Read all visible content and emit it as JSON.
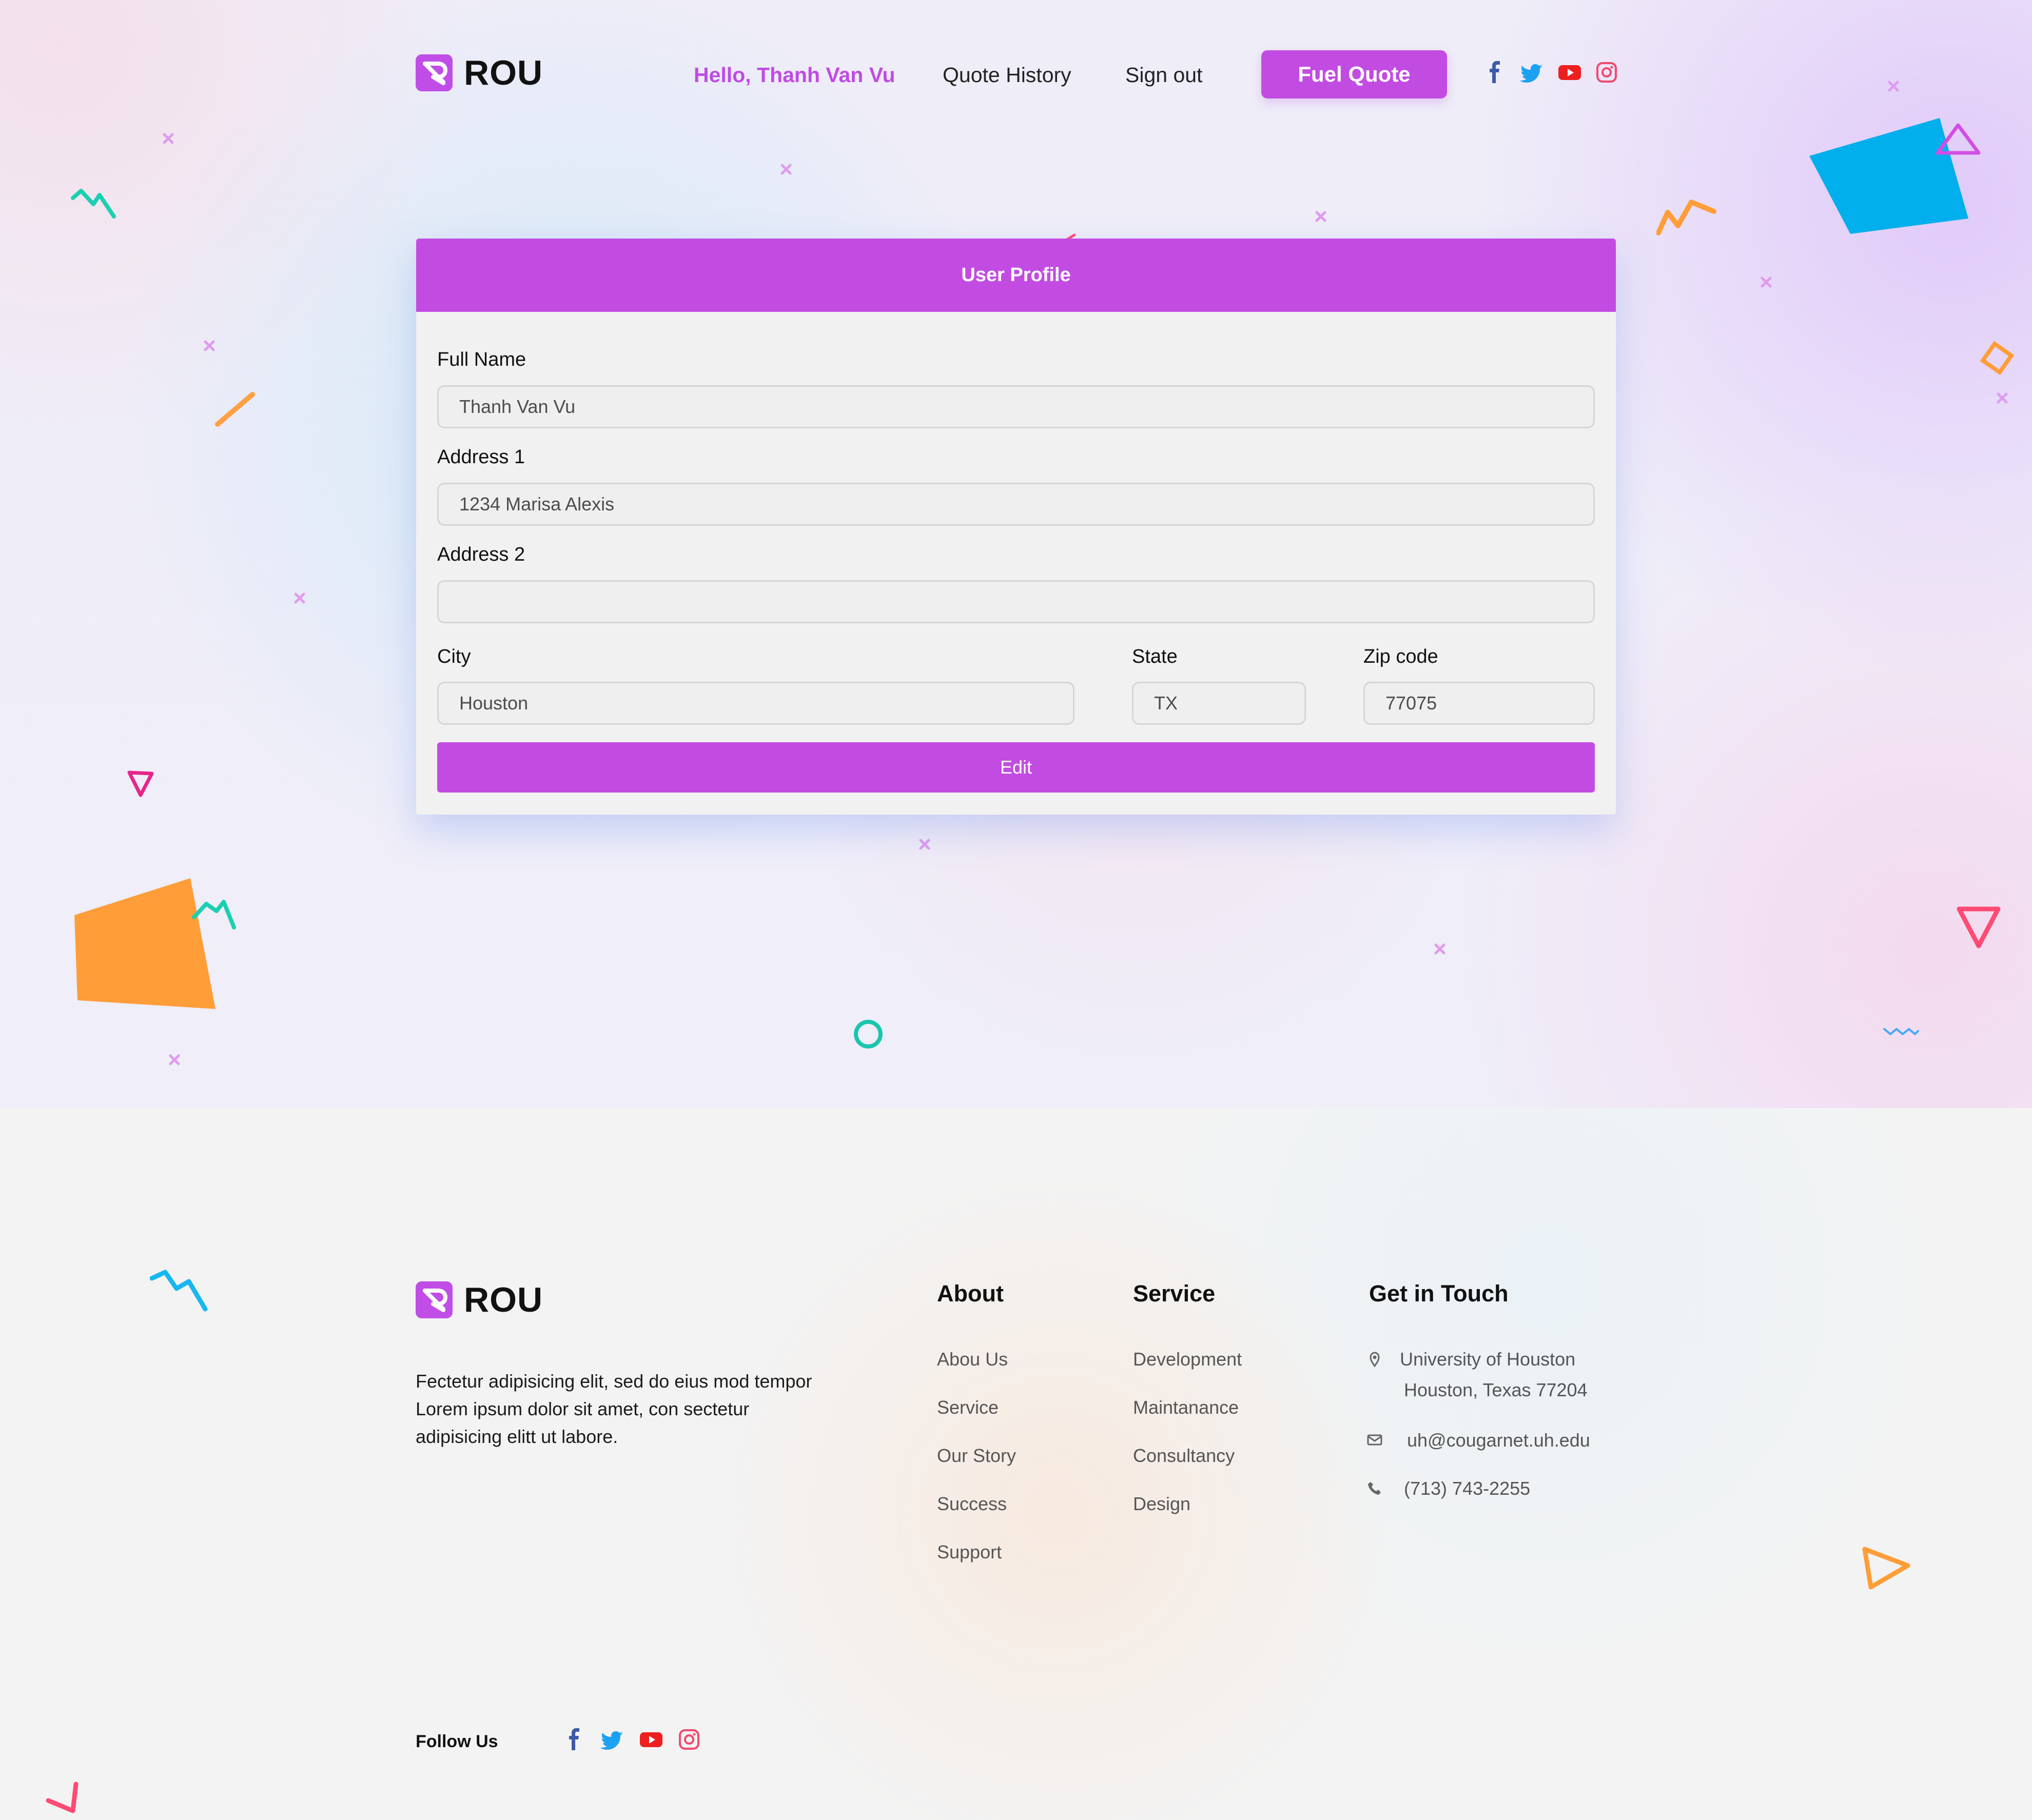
{
  "colors": {
    "brand": "#C24CE2",
    "brand_text": "#BF4BE3",
    "card_bg": "#F2F1F1",
    "field_border": "#D5D5D8"
  },
  "header": {
    "logo_text": "ROU",
    "greeting": "Hello, Thanh Van Vu",
    "quote_history": "Quote History",
    "sign_out": "Sign out",
    "fuel_quote": "Fuel Quote",
    "social_icons": [
      "facebook-icon",
      "twitter-icon",
      "youtube-icon",
      "instagram-icon"
    ]
  },
  "profile": {
    "title": "User Profile",
    "full_name_label": "Full Name",
    "full_name_value": "Thanh Van Vu",
    "address1_label": "Address 1",
    "address1_value": "1234 Marisa Alexis",
    "address2_label": "Address 2",
    "address2_value": "",
    "city_label": "City",
    "city_value": "Houston",
    "state_label": "State",
    "state_value": "TX",
    "zip_label": "Zip code",
    "zip_value": "77075",
    "edit_button": "Edit"
  },
  "footer": {
    "logo_text": "ROU",
    "description": "Fectetur adipisicing elit, sed do eius mod tempor Lorem ipsum dolor sit amet, con sectetur adipisicing elitt ut labore.",
    "about_title": "About",
    "about_links": [
      "Abou Us",
      "Service",
      "Our Story",
      "Success",
      "Support"
    ],
    "service_title": "Service",
    "service_links": [
      "Development",
      "Maintanance",
      "Consultancy",
      "Design"
    ],
    "contact_title": "Get in Touch",
    "address_line1": "University of Houston",
    "address_line2": "Houston, Texas 77204",
    "email": "uh@cougarnet.uh.edu",
    "phone": "(713) 743-2255",
    "follow_us": "Follow Us",
    "social_icons": [
      "facebook-icon",
      "twitter-icon",
      "youtube-icon",
      "instagram-icon"
    ]
  }
}
